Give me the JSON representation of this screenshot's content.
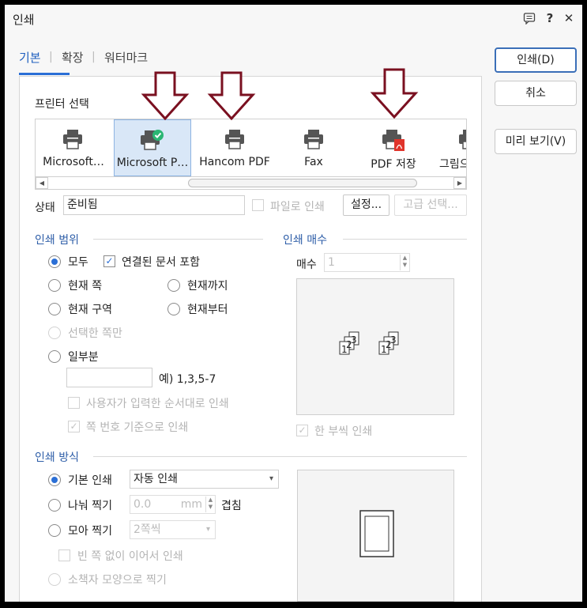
{
  "window": {
    "title": "인쇄",
    "icons": [
      "comment-icon",
      "help-icon",
      "close-icon"
    ],
    "help_glyph": "?",
    "close_glyph": "✕"
  },
  "tabs": [
    {
      "label": "기본",
      "active": true
    },
    {
      "label": "확장",
      "active": false
    },
    {
      "label": "워터마크",
      "active": false
    }
  ],
  "tab_separator": "|",
  "buttons": {
    "print": "인쇄(D)",
    "cancel": "취소",
    "preview": "미리 보기(V)"
  },
  "printer_select": {
    "label": "프린터 선택",
    "printers": [
      {
        "name": "Microsoft…",
        "icon": "printer-icon",
        "selected": false
      },
      {
        "name": "Microsoft P…",
        "icon": "printer-default-icon",
        "selected": true
      },
      {
        "name": "Hancom PDF",
        "icon": "printer-icon",
        "selected": false
      },
      {
        "name": "Fax",
        "icon": "printer-icon",
        "selected": false
      },
      {
        "name": "PDF 저장",
        "icon": "printer-pdf-icon",
        "selected": false
      },
      {
        "name": "그림으",
        "icon": "printer-icon",
        "selected": false
      }
    ],
    "scroll_left": "◀",
    "scroll_right": "▶"
  },
  "status": {
    "label": "상태",
    "value": "준비됨",
    "print_to_file": "파일로 인쇄",
    "settings": "설정...",
    "advanced": "고급 선택..."
  },
  "print_range": {
    "title": "인쇄 범위",
    "all": "모두",
    "include_linked": "연결된 문서 포함",
    "current_page": "현재 쪽",
    "up_to_current": "현재까지",
    "current_section": "현재 구역",
    "from_current": "현재부터",
    "selected_only": "선택한 쪽만",
    "partial": "일부분",
    "partial_example": "예) 1,3,5-7",
    "user_order": "사용자가 입력한 순서대로 인쇄",
    "by_page_number": "쪽 번호 기준으로 인쇄"
  },
  "copies": {
    "title": "인쇄 매수",
    "label": "매수",
    "value": "1",
    "collate": "한 부씩 인쇄",
    "preview_digits": [
      "1",
      "2",
      "3",
      "1",
      "2",
      "3"
    ]
  },
  "print_method": {
    "title": "인쇄 방식",
    "basic": "기본 인쇄",
    "basic_mode": "자동 인쇄",
    "split": "나눠 찍기",
    "split_value": "0.0",
    "split_unit": "mm",
    "overlap": "겹침",
    "gather": "모아 찍기",
    "gather_value": "2쪽씩",
    "no_blank": "빈 쪽 없이 이어서 인쇄",
    "booklet": "소책자 모양으로 찍기"
  },
  "colors": {
    "accent": "#2b6fd6",
    "section_title": "#2e5ea8",
    "annotation_arrow": "#7a1020",
    "pdf_red": "#e0342b",
    "default_check": "#2bb673"
  },
  "glyphs": {
    "check": "✓",
    "dropdown": "▾",
    "spin_up": "▲",
    "spin_down": "▼"
  }
}
